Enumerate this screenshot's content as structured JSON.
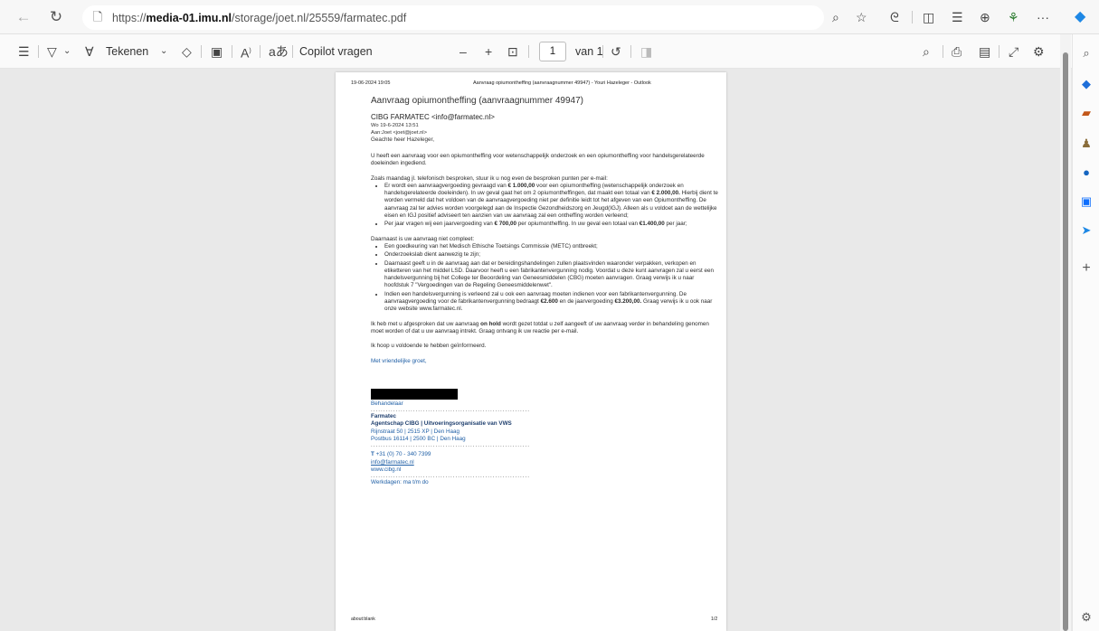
{
  "browser": {
    "url_prefix": "https://",
    "url_domain": "media-01.imu.nl",
    "url_path": "/storage/joet.nl/25559/farmatec.pdf"
  },
  "pdf_toolbar": {
    "draw_label": "Tekenen",
    "copilot_label": "Copilot vragen",
    "minus": "–",
    "plus": "+",
    "page_current": "1",
    "page_total": "van 1"
  },
  "document": {
    "header_date": "19-06-2024 19:05",
    "header_title": "Aanvraag opiumontheffing (aanvraagnummer 49947) - Youri Hazeleger - Outlook",
    "subject": "Aanvraag opiumontheffing (aanvraagnummer 49947)",
    "from": "CIBG FARMATEC <info@farmatec.nl>",
    "date": "Wo 19-6-2024 13:51",
    "to": "Aan:Joet <joet@joet.nl>",
    "greeting": "Geachte heer Hazeleger,",
    "para1": "U heeft een aanvraag voor een opiumontheffing voor wetenschappelijk onderzoek en een opiumontheffing voor handelsgerelateerde doeleinden ingediend.",
    "intro2": "Zoals maandag jl. telefonisch besproken, stuur ik u nog even de besproken punten per e-mail:",
    "b1a": "Er wordt een aanvraagvergoeding gevraagd van ",
    "b1b": "€ 1.000,00",
    "b1c": " voor een opiumontheffing (wetenschappelijk onderzoek en handelsgerelateerde doeleinden). In uw geval gaat het om 2 opiumontheffingen, dat maakt een totaal van ",
    "b1d": "€ 2.000,00.",
    "b1e": " Hierbij dient te worden vermeld dat het voldoen van de aanvraagvergoeding niet per definitie leidt tot het afgeven van een Opiumontheffing. De aanvraag zal ter advies worden voorgelegd aan de Inspectie Gezondheidszorg en Jeugd(IGJ). Alleen als u voldoet aan de wettelijke eisen en IGJ positief adviseert ten aanzien van uw aanvraag zal een ontheffing worden verleend;",
    "b2a": "Per jaar vragen wij een jaarvergoeding van ",
    "b2b": "€ 700,00",
    "b2c": " per opiumontheffing. In uw geval een totaal van ",
    "b2d": "€1.400,00",
    "b2e": " per jaar;",
    "intro3": "Daarnaast is uw aanvraag niet compleet:",
    "c1": "Een goedkeuring van het Medisch Ethische Toetsings Commissie (METC) ontbreekt;",
    "c2": "Onderzoekslab dient aanwezig te zijn;",
    "c3": "Daarnaast geeft u in de aanvraag aan dat er bereidingshandelingen zullen plaatsvinden waaronder verpakken, verkopen en etiketteren van het middel LSD. Daarvoor heeft u een fabrikantenvergunning nodig. Voordat u deze kunt aanvragen zal u eerst een handelsvergunning bij het College ter Beoordeling van Geneesmiddelen (CBG) moeten aanvragen. Graag verwijs ik u naar hoofdstuk 7 \"Vergoedingen van de Regeling Geneesmiddelenwet\".",
    "c4a": "Indien een handelsvergunning is verleend zal u ook een aanvraag moeten indienen voor een fabrikantenvergunning. De aanvraagvergoeding voor de fabrikantenvergunning bedraagt ",
    "c4b": "€2.600",
    "c4c": " en de jaarvergoeding ",
    "c4d": "€3.200,00.",
    "c4e": " Graag verwijs ik u ook naar onze website www.farmatec.nl.",
    "p4a": "Ik heb met u afgesproken dat uw aanvraag ",
    "p4b": "on hold",
    "p4c": " wordt gezet totdat u zelf aangeeft of uw aanvraag verder in behandeling genomen moet worden of dat u uw aanvraag intrekt. Graag ontvang ik uw reactie per e-mail.",
    "p5": "Ik hoop u voldoende te hebben geïnformeerd.",
    "closing": "Met vriendelijke groet,",
    "role": "Behandelaar",
    "dots": "................................................................",
    "org": "Farmatec",
    "agency": "Agentschap CIBG | Uitvoeringsorganisatie van VWS",
    "addr1": "Rijnstraat 50 | 2515 XP | Den Haag",
    "addr2": "Postbus 16114 | 2500 BC | Den Haag",
    "phone_label": "T",
    "phone": " +31 (0) 70 - 340 7399",
    "email": "info@farmatec.nl",
    "web": "www.cibg.nl",
    "workdays": "Werkdagen: ma t/m do",
    "footer_left": "about:blank",
    "footer_right": "1/2"
  }
}
